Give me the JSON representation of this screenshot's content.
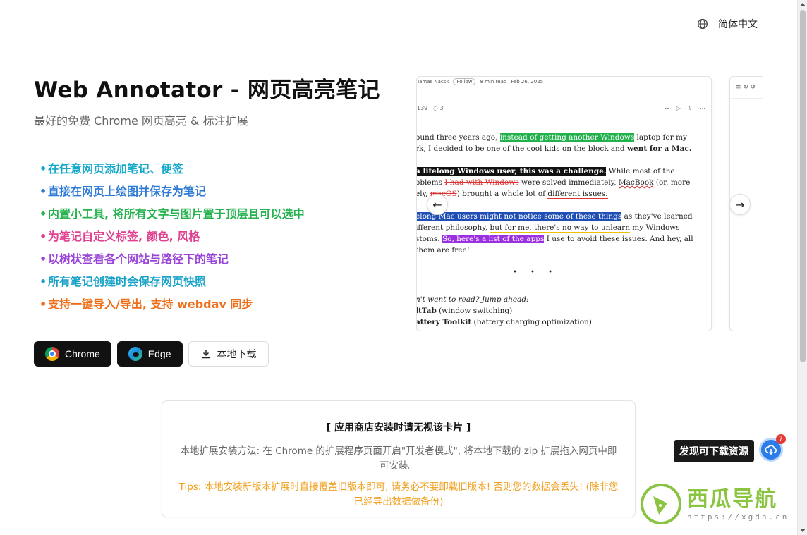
{
  "header": {
    "language_label": "简体中文"
  },
  "hero": {
    "title": "Web Annotator - 网页高亮笔记",
    "subtitle": "最好的免费 Chrome 网页高亮 & 标注扩展",
    "features": [
      {
        "text": "在任意网页添加笔记、便签",
        "color": "#14a8c9"
      },
      {
        "text": "直接在网页上绘图并保存为笔记",
        "color": "#2d7ad6"
      },
      {
        "text": "内置小工具, 将所有文字与图片置于顶层且可以选中",
        "color": "#25b24f"
      },
      {
        "text": "为笔记自定义标签, 颜色, 风格",
        "color": "#e0408f"
      },
      {
        "text": "以树状查看各个网站与路径下的笔记",
        "color": "#9a45d8"
      },
      {
        "text": "所有笔记创建时会保存网页快照",
        "color": "#1aa3c9"
      },
      {
        "text": "支持一键导入/导出, 支持 webdav 同步",
        "color": "#ee6f1a"
      }
    ],
    "buttons": {
      "chrome": "Chrome",
      "edge": "Edge",
      "local": "本地下载"
    }
  },
  "preview": {
    "meta_author": "Tamas Nacsk",
    "meta_follow": "Follow",
    "meta_read": "8 min read",
    "meta_date": "Feb 26, 2025",
    "claps": "139",
    "comments": "3",
    "p1a": "ound three years ago, ",
    "p1_hl": "instead of getting another Windows",
    "p1b": " laptop for my",
    "p1c": "rk, I decided to be one of the cool kids on the block and ",
    "p1d": "went for a Mac.",
    "p2_hl": "a lifelong Windows user, this was a challenge.",
    "p2a": " While most of the",
    "p2b": "oblems ",
    "p2_strike": "I had with Windows",
    "p2c": " were solved immediately, ",
    "p2_wave": "MacBook",
    "p2d": " (or, more",
    "p2e": "ely, ",
    "p2_strike2": "macOS",
    "p2f": ") brought a whole lot of ",
    "p2_under": "different issues.",
    "p3_hl": "elong Mac users might not notice some of these things",
    "p3a": " as they've learned",
    "p3b": "ifferent philosophy, ",
    "p3_yellow": "but for me, there's no way to unlearn",
    "p3c": " my Windows",
    "p3d": "stoms. ",
    "p3_hl2": "So, here's a list of the apps",
    "p3e": " I use to avoid these issues. And hey, all",
    "p3f": "them are free!",
    "sep": "• • •",
    "jump": "n't want to read? Jump ahead:",
    "item1a": "ltTab",
    "item1b": " (window switching)",
    "item2a": "attery Toolkit",
    "item2b": " (battery charging optimization)",
    "slide2_toolbar": "≡  ↻  ↺"
  },
  "install_card": {
    "title": "[ 应用商店安装时请无视该卡片 ]",
    "desc": "本地扩展安装方法: 在 Chrome 的扩展程序页面开启\"开发者模式\", 将本地下载的 zip 扩展拖入网页中即可安装。",
    "tips": "Tips: 本地安装新版本扩展时直接覆盖旧版本即可, 请务必不要卸载旧版本! 否则您的数据会丢失! (除非您已经导出数据做备份)"
  },
  "floating": {
    "found_label": "发现可下载资源",
    "badge_count": "7"
  },
  "watermark": {
    "title": "西瓜导航",
    "url": "https://xgdh.cn"
  }
}
